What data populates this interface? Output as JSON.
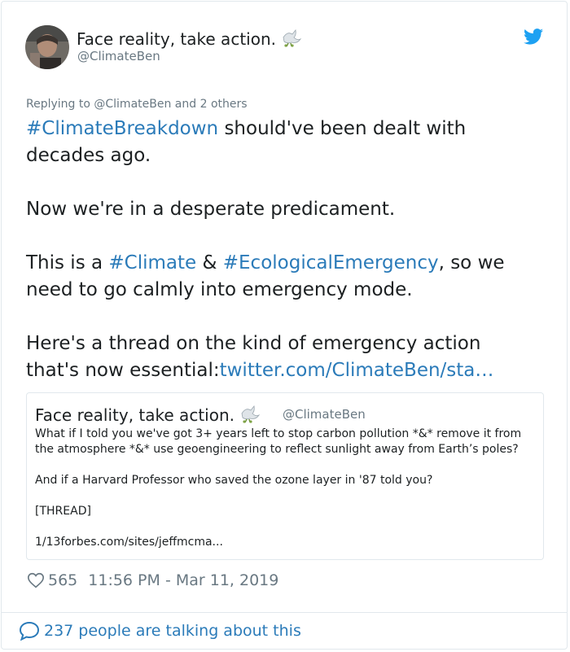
{
  "author": {
    "display_name": "Face reality, take action.",
    "handle": "@ClimateBen",
    "name_emoji": "dove-icon"
  },
  "reply_context": "Replying to @ClimateBen and 2 others",
  "tweet": {
    "p1_link": "#ClimateBreakdown",
    "p1_rest": " should've been dealt with decades ago.",
    "p2": "Now we're in a desperate predicament.",
    "p3_a": "This is a ",
    "p3_link1": "#Climate",
    "p3_b": " & ",
    "p3_link2": "#EcologicalEmergency",
    "p3_c": ", so we need to go calmly into emergency mode.",
    "p4_text": "Here's a thread on the kind of emergency action that's now essential:",
    "p4_link": "twitter.com/ClimateBen/sta…"
  },
  "quoted_tweet": {
    "display_name": "Face reality, take action.",
    "handle": "@ClimateBen",
    "line1": "What if I told you we've got 3+ years left to stop carbon pollution *&* remove it from the atmosphere *&* use geoengineering to reflect sunlight away from Earth’s poles?",
    "line2": "And if a Harvard Professor who saved the ozone layer in '87 told you?",
    "line3": "[THREAD]",
    "line4": "1/13forbes.com/sites/jeffmcma..."
  },
  "likes_count": "565",
  "timestamp": "11:56 PM - Mar 11, 2019",
  "talking_text": "237 people are talking about this",
  "colors": {
    "link": "#2b7bb9",
    "secondary_text": "#697882",
    "border": "#e1e8ed",
    "twitter_blue": "#1da1f2"
  }
}
